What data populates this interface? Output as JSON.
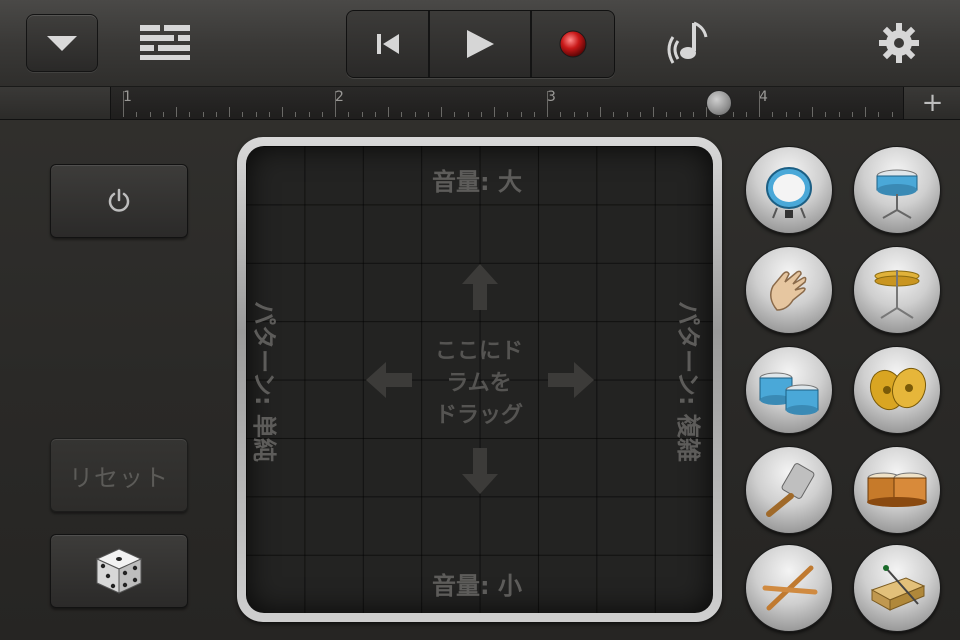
{
  "ruler": {
    "marks": [
      "1",
      "2",
      "3",
      "4"
    ],
    "add_label": "+"
  },
  "left_panel": {
    "reset_label": "リセット"
  },
  "pad": {
    "top_label": "音量: 大",
    "bottom_label": "音量: 小",
    "left_label": "パターン: 単純",
    "right_label": "パターン: 複雑",
    "center_lines": [
      "ここにド",
      "ラムを",
      "ドラッグ"
    ]
  },
  "icons": {
    "menu": "chevron-down-icon",
    "tracks": "tracks-view-icon",
    "rewind": "skip-back-icon",
    "play": "play-icon",
    "record": "record-icon",
    "instrument_settings": "music-note-icon",
    "settings": "gear-icon",
    "power": "power-icon",
    "dice": "dice-icon"
  },
  "instruments": [
    "kick-drum-icon",
    "snare-drum-icon",
    "hand-clap-icon",
    "hi-hat-icon",
    "toms-icon",
    "crash-cymbal-icon",
    "shaker-icon",
    "percussion-icon",
    "sticks-icon",
    "wood-block-icon"
  ],
  "colors": {
    "record": "#c81818",
    "pad_text": "#5d5c5a",
    "background": "#2b2a28"
  }
}
